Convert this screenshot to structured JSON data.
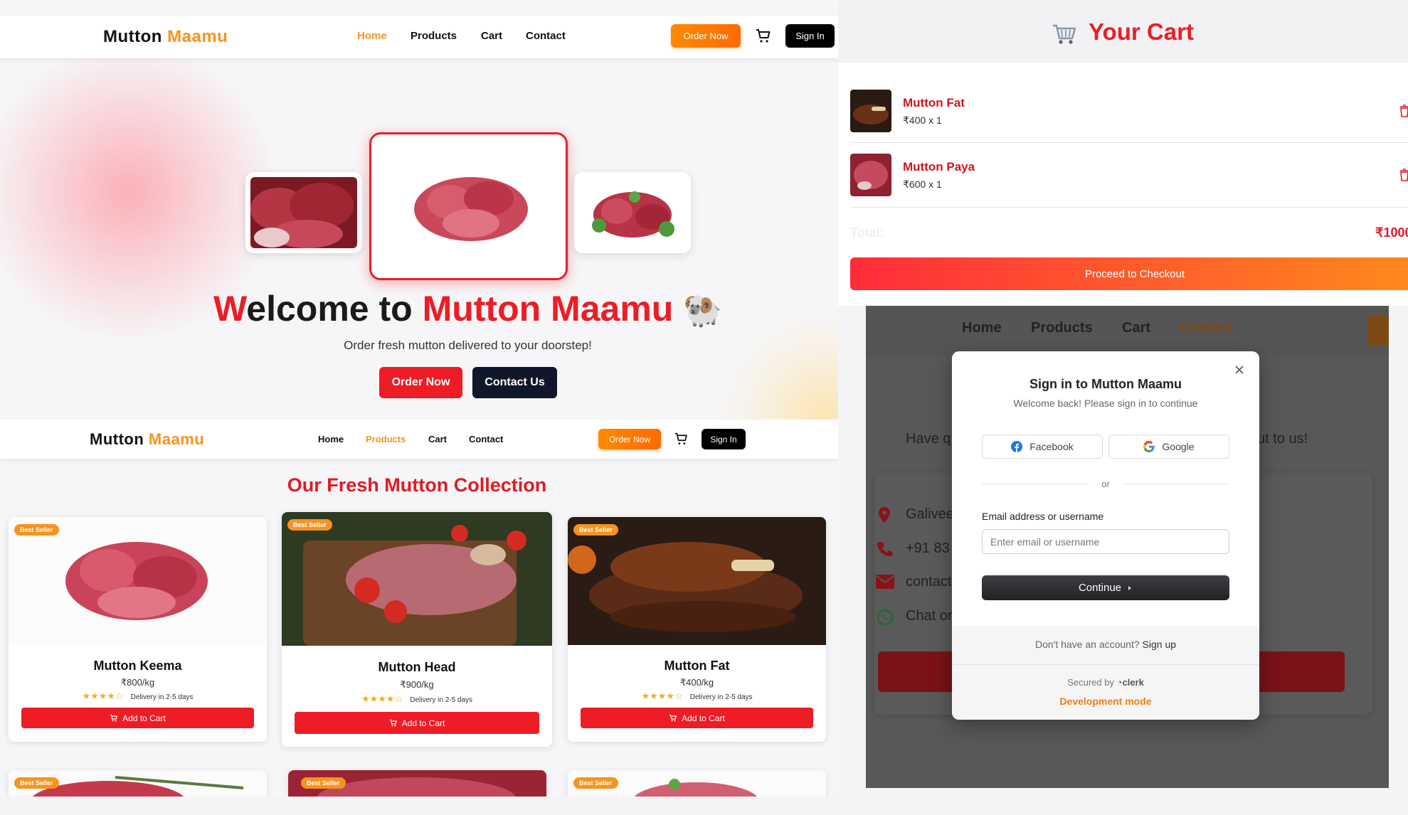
{
  "home": {
    "nav": {
      "logo_part1": "Mutton",
      "logo_part2": "Maamu",
      "links": [
        "Home",
        "Products",
        "Cart",
        "Contact"
      ],
      "active_link": "Home",
      "order_button": "Order Now",
      "signin_button": "Sign In"
    },
    "hero": {
      "title_w": "W",
      "title_rest": "elcome to ",
      "title_brand": "Mutton Maamu",
      "title_emoji": "🐏",
      "subtitle": "Order fresh mutton delivered to your doorstep!",
      "order_button": "Order Now",
      "contact_button": "Contact Us"
    }
  },
  "products": {
    "nav": {
      "logo_part1": "Mutton",
      "logo_part2": "Maamu",
      "links": [
        "Home",
        "Products",
        "Cart",
        "Contact"
      ],
      "active_link": "Products",
      "order_button": "Order Now",
      "signin_button": "Sign In"
    },
    "title": "Our Fresh Mutton Collection",
    "items": [
      {
        "badge": "Best Seller",
        "name": "Mutton Keema",
        "price": "₹800/kg",
        "stars": "★★★★☆",
        "delivery": "Delivery in 2-5 days",
        "button": "Add to Cart"
      },
      {
        "badge": "Best Seller",
        "name": "Mutton Head",
        "price": "₹900/kg",
        "stars": "★★★★☆",
        "delivery": "Delivery in 2-5 days",
        "button": "Add to Cart"
      },
      {
        "badge": "Best Seller",
        "name": "Mutton Fat",
        "price": "₹400/kg",
        "stars": "★★★★☆",
        "delivery": "Delivery in 2-5 days",
        "button": "Add to Cart"
      }
    ],
    "bottom_badges": [
      "Best Seller",
      "Best Seller",
      "Best Seller"
    ]
  },
  "cart": {
    "title": "Your Cart",
    "items": [
      {
        "name": "Mutton Fat",
        "qty": "₹400 x 1"
      },
      {
        "name": "Mutton Paya",
        "qty": "₹600 x 1"
      }
    ],
    "total_label": "Total:",
    "total_value": "₹1000",
    "checkout_button": "Proceed to Checkout"
  },
  "contact_bg": {
    "nav": [
      "Home",
      "Products",
      "Cart",
      "Contact"
    ],
    "intro_left": "Have q",
    "intro_right": "ut to us!",
    "info": [
      "Galivee",
      "+91 83",
      "contact",
      "Chat or"
    ]
  },
  "signin": {
    "title": "Sign in to Mutton Maamu",
    "subtitle": "Welcome back! Please sign in to continue",
    "facebook": "Facebook",
    "google": "Google",
    "or": "or",
    "email_label": "Email address or username",
    "email_placeholder": "Enter email or username",
    "continue": "Continue",
    "no_account": "Don't have an account?",
    "signup": "Sign up",
    "secured_by": "Secured by",
    "clerk": "clerk",
    "dev_mode": "Development mode"
  },
  "colors": {
    "brand_red": "#ee1c25",
    "brand_orange": "#f7931e",
    "dark": "#111111"
  }
}
